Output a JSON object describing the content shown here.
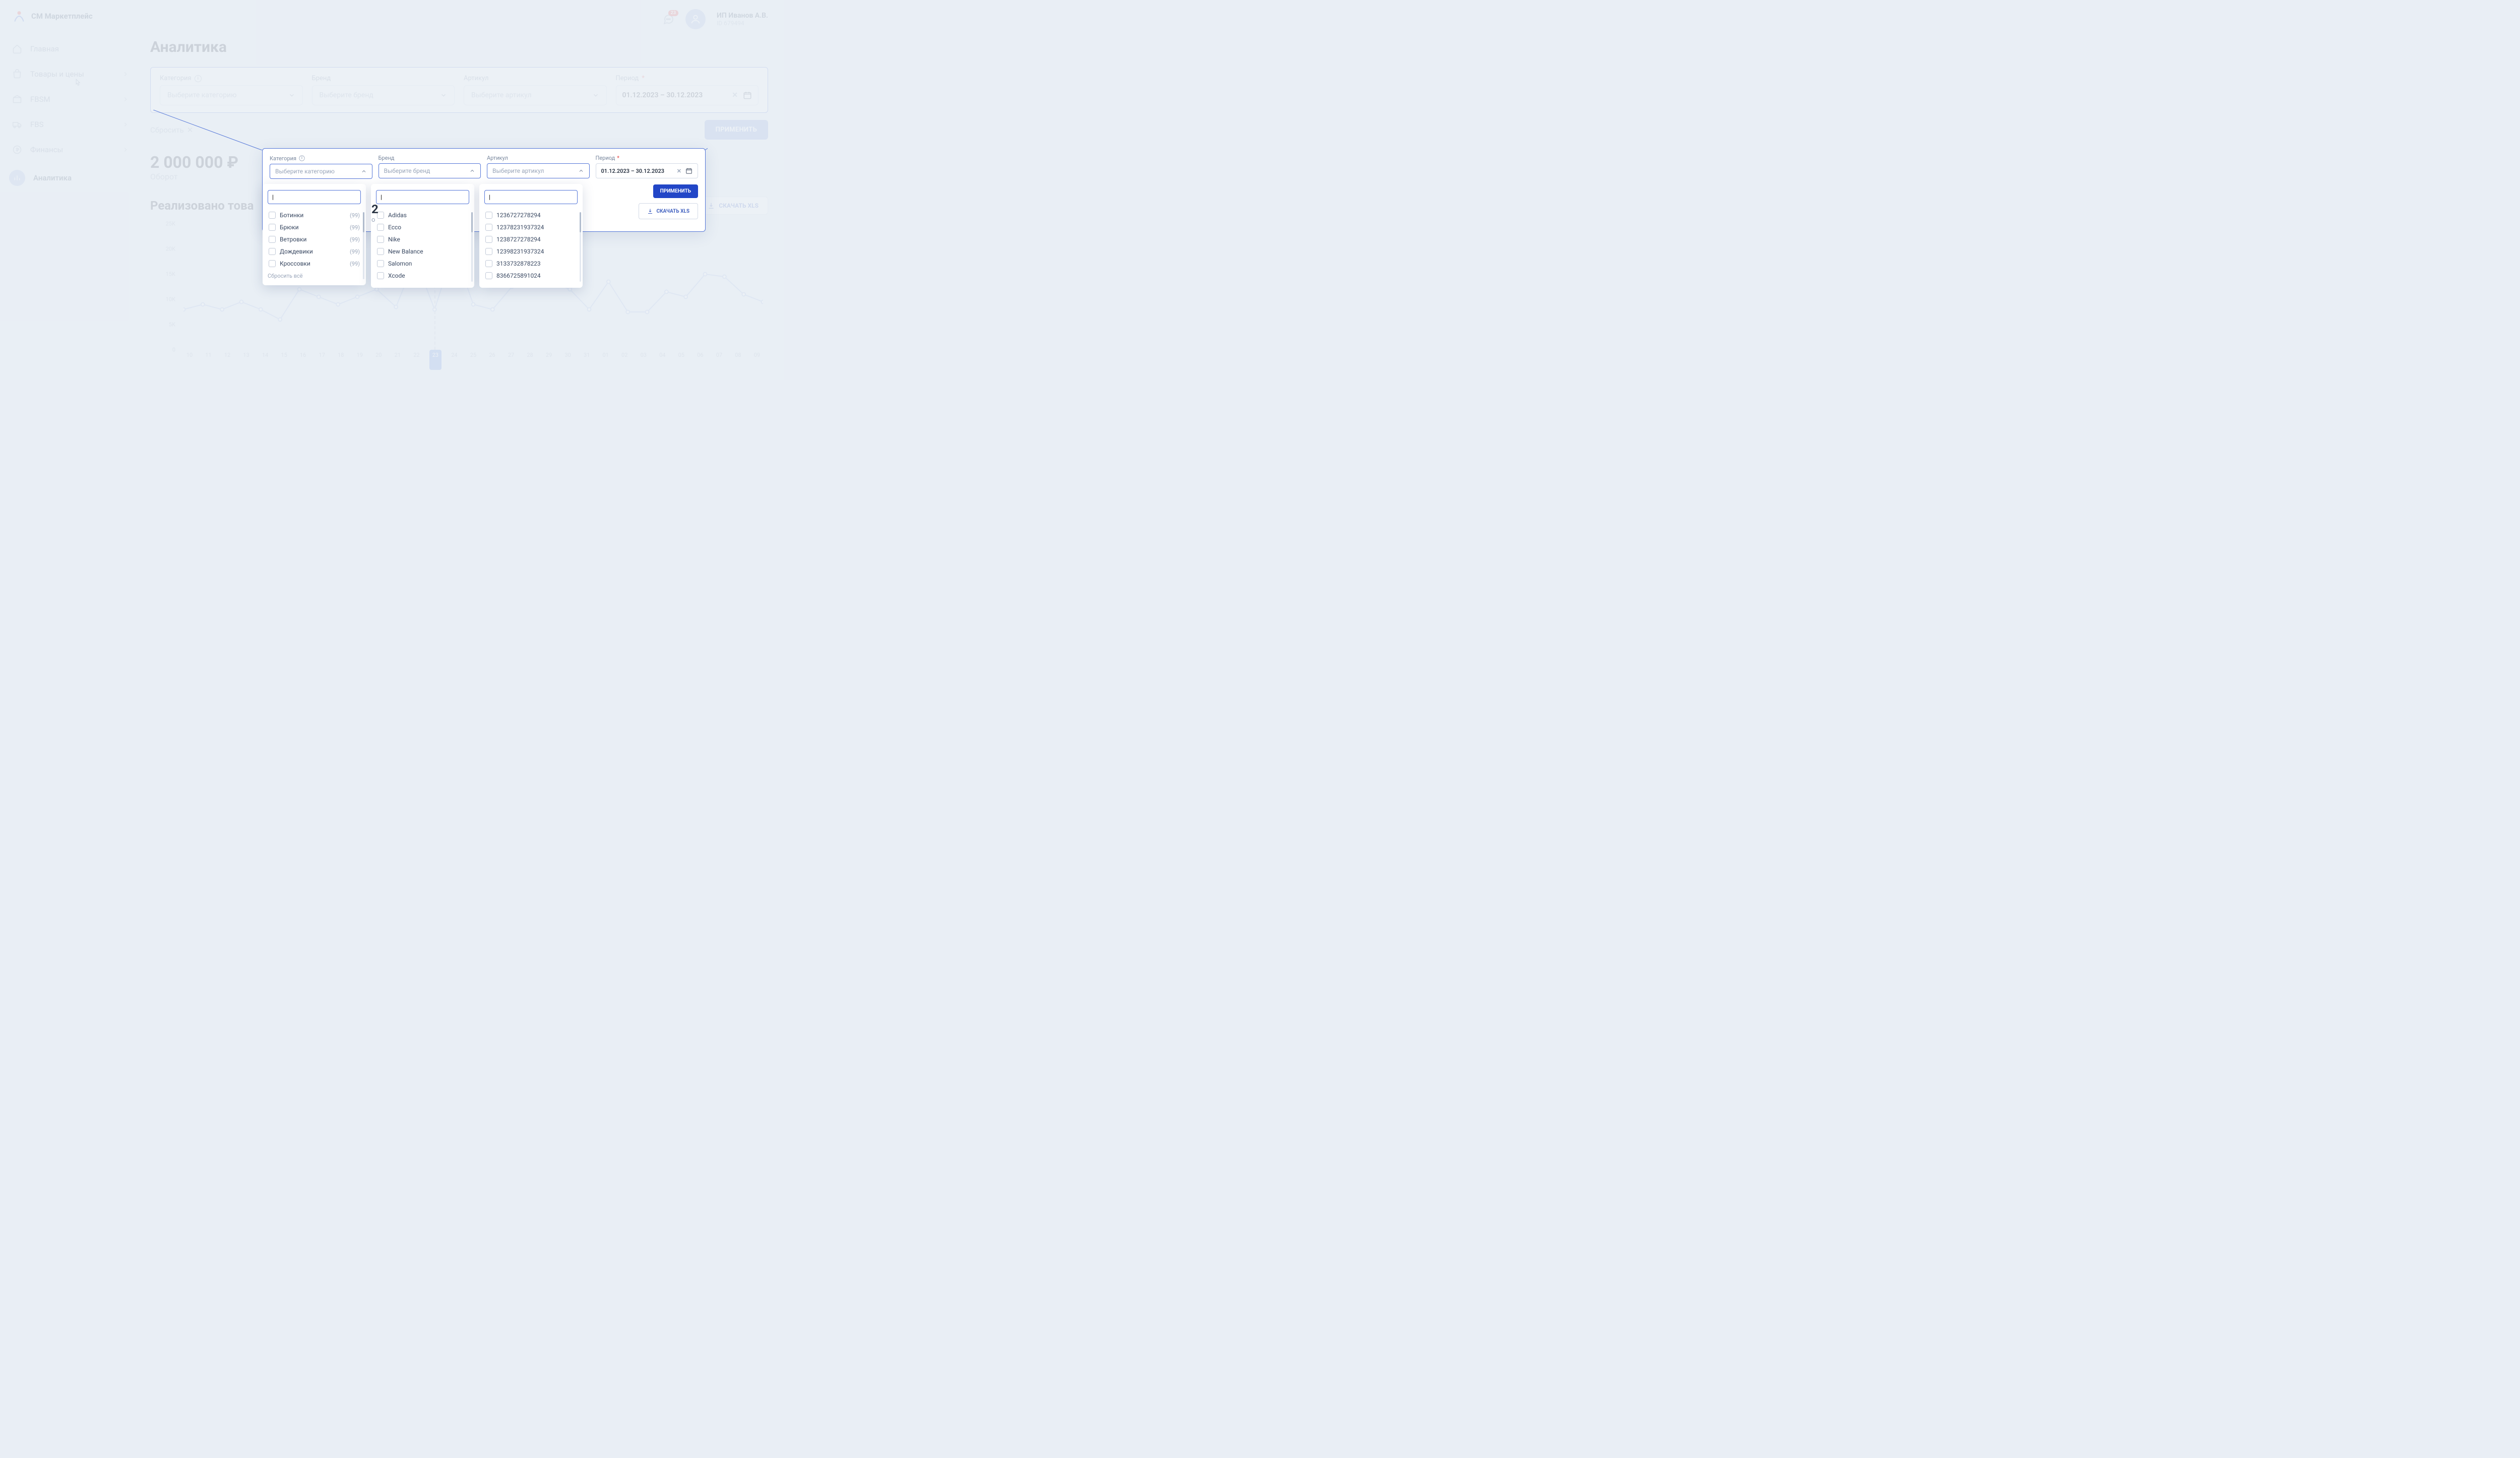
{
  "app_name": "СМ Маркетплейс",
  "nav": [
    {
      "label": "Главная",
      "icon": "home"
    },
    {
      "label": "Товары и цены",
      "icon": "products",
      "chev": true
    },
    {
      "label": "FBSM",
      "icon": "warehouse",
      "chev": true
    },
    {
      "label": "FBS",
      "icon": "truck",
      "chev": true
    },
    {
      "label": "Финансы",
      "icon": "finance",
      "chev": true
    },
    {
      "label": "Аналитика",
      "icon": "analytics",
      "active": true
    }
  ],
  "notif_count": "23",
  "user": {
    "name": "ИП Иванов А.В.",
    "id": "ID 679494"
  },
  "page_title": "Аналитика",
  "filter": {
    "category": {
      "label": "Категория",
      "placeholder": "Выберите категорию"
    },
    "brand": {
      "label": "Бренд",
      "placeholder": "Выберите бренд"
    },
    "article": {
      "label": "Артикул",
      "placeholder": "Выберите артикул"
    },
    "period": {
      "label": "Период",
      "value": "01.12.2023 – 30.12.2023"
    }
  },
  "reset_label": "Сбросить",
  "apply_label": "ПРИМЕНИТЬ",
  "kpi": {
    "value": "2 000 000 ₽",
    "label": "Оборот"
  },
  "section_title": "Реализовано това",
  "download_label": "СКАЧАТЬ XLS",
  "chart_data": {
    "type": "line",
    "ylim": [
      0,
      25000
    ],
    "y_ticks": [
      "25K",
      "20K",
      "15K",
      "10K",
      "5K",
      "0"
    ],
    "x_labels": [
      "10",
      "11",
      "12",
      "13",
      "14",
      "15",
      "16",
      "17",
      "18",
      "19",
      "20",
      "21",
      "22",
      "23",
      "24",
      "25",
      "26",
      "27",
      "28",
      "29",
      "30",
      "31",
      "01",
      "02",
      "03",
      "04",
      "05",
      "06",
      "07",
      "08",
      "09"
    ],
    "active_x": "23",
    "values": [
      8000,
      9000,
      8000,
      9500,
      8000,
      6000,
      12000,
      10500,
      9000,
      10500,
      12000,
      8500,
      18000,
      8000,
      20000,
      9000,
      8000,
      12500,
      15000,
      13500,
      12000,
      8000,
      13500,
      7500,
      7500,
      11500,
      10500,
      15000,
      14500,
      11000,
      9500
    ]
  },
  "expanded": {
    "apply": "ПРИМЕНИТЬ",
    "download": "СКАЧАТЬ XLS",
    "reset_all": "Сбросить всё",
    "categories": [
      {
        "label": "Ботинки",
        "count": "(99)"
      },
      {
        "label": "Брюки",
        "count": "(99)"
      },
      {
        "label": "Ветровки",
        "count": "(99)"
      },
      {
        "label": "Дождевики",
        "count": "(99)"
      },
      {
        "label": "Кроссовки",
        "count": "(99)"
      }
    ],
    "brands": [
      "Adidas",
      "Ecco",
      "Nike",
      "New Balance",
      "Salomon",
      "Xcode"
    ],
    "articles": [
      "1236727278294",
      "12378231937324",
      "1238727278294",
      "12398231937324",
      "3133732878223",
      "8366725891024"
    ]
  },
  "behind_kpi": {
    "value_partial": "2",
    "label_partial": "о"
  }
}
